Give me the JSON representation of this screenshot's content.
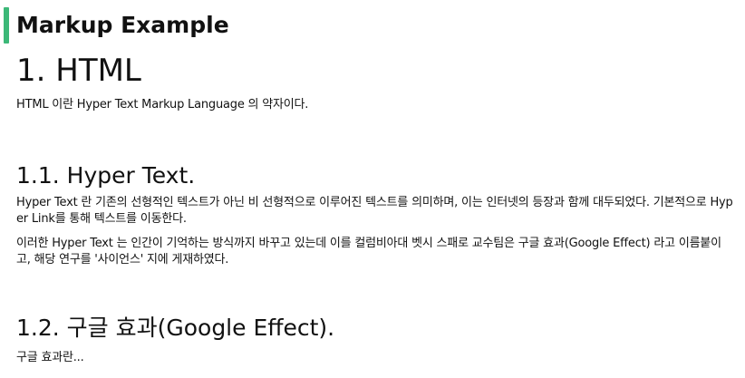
{
  "page": {
    "title": "Markup Example",
    "accent_color": "#3cb878"
  },
  "sections": {
    "html": {
      "heading": "1. HTML",
      "text": "HTML 이란 Hyper Text Markup Language 의 약자이다."
    },
    "hyper_text": {
      "heading": "1.1. Hyper Text.",
      "paragraphs": [
        "Hyper Text 란 기존의 선형적인 텍스트가 아닌 비 선형적으로 이루어진 텍스트를 의미하며, 이는 인터넷의 등장과 함께 대두되었다. 기본적으로 Hyper Link를 통해 텍스트를 이동한다.",
        "이러한 Hyper Text 는 인간이 기억하는 방식까지 바꾸고 있는데 이를 컬럼비아대 벳시 스패로 교수팀은 구글 효과(Google Effect) 라고 이름붙이고, 해당 연구를 '사이언스' 지에 게재하였다."
      ]
    },
    "google_effect": {
      "heading": "1.2. 구글 효과(Google Effect).",
      "text": "구글 효과란..."
    }
  }
}
